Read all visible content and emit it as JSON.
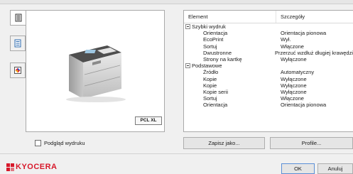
{
  "table": {
    "col_element": "Element",
    "col_details": "Szczegóły",
    "rows": [
      {
        "type": "group",
        "label": "Szybki wydruk",
        "value": ""
      },
      {
        "type": "item",
        "label": "Orientacja",
        "value": "Orientacja pionowa"
      },
      {
        "type": "item",
        "label": "EcoPrint",
        "value": "Wył."
      },
      {
        "type": "item",
        "label": "Sortuj",
        "value": "Włączone"
      },
      {
        "type": "item",
        "label": "Dwustronne",
        "value": "Przerzuć wzdłuż długiej krawędzi"
      },
      {
        "type": "item",
        "label": "Strony na kartkę",
        "value": "Wyłączone"
      },
      {
        "type": "group",
        "label": "Podstawowe",
        "value": ""
      },
      {
        "type": "item",
        "label": "Źródło",
        "value": "Automatyczny"
      },
      {
        "type": "item",
        "label": "Kopie",
        "value": "Wyłączone"
      },
      {
        "type": "item",
        "label": "Kopie",
        "value": "Wyłączone"
      },
      {
        "type": "item",
        "label": "Kopie serii",
        "value": "Wyłączone"
      },
      {
        "type": "item",
        "label": "Sortuj",
        "value": "Włączone"
      },
      {
        "type": "item",
        "label": "Orientacja",
        "value": "Orientacja pionowa"
      }
    ]
  },
  "preview": {
    "pdl_badge": "PCL XL",
    "checkbox_label": "Podgląd wydruku"
  },
  "buttons": {
    "save_as": "Zapisz jako...",
    "profiles": "Profile...",
    "ok": "OK",
    "cancel": "Anuluj"
  },
  "logo": {
    "text": "KYOCERA",
    "color": "#d7182a"
  },
  "icons": [
    "print-settings-icon",
    "document-list-icon",
    "color-icon",
    "kyocera-logo-icon"
  ]
}
